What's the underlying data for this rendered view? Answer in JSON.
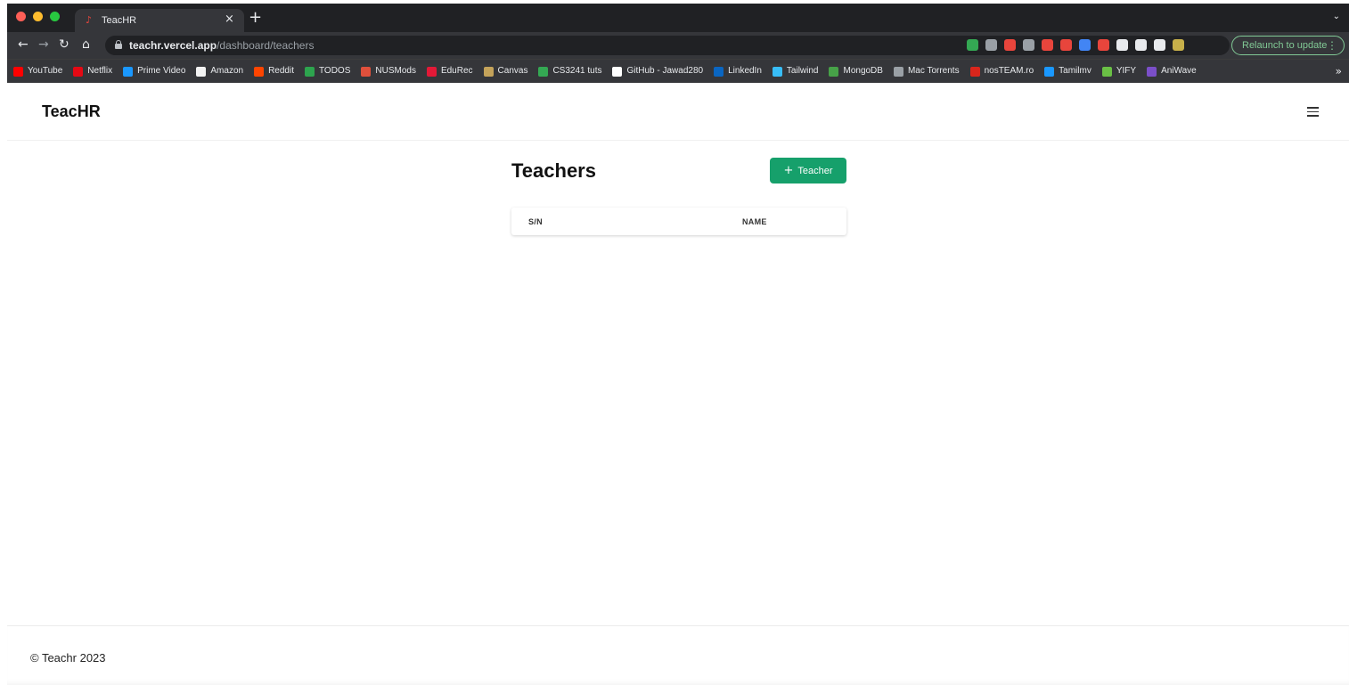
{
  "browser": {
    "tab_title": "TeacHR",
    "url_host": "teachr.vercel.app",
    "url_path": "/dashboard/teachers",
    "relaunch_label": "Relaunch to update",
    "bookmarks": [
      {
        "label": "YouTube",
        "color": "#ff0000"
      },
      {
        "label": "Netflix",
        "color": "#e50914"
      },
      {
        "label": "Prime Video",
        "color": "#1a98ff"
      },
      {
        "label": "Amazon",
        "color": "#f2f2f2"
      },
      {
        "label": "Reddit",
        "color": "#ff4500"
      },
      {
        "label": "TODOS",
        "color": "#2da44e"
      },
      {
        "label": "NUSMods",
        "color": "#e0503c"
      },
      {
        "label": "EduRec",
        "color": "#e31937"
      },
      {
        "label": "Canvas",
        "color": "#c4a35a"
      },
      {
        "label": "CS3241 tuts",
        "color": "#34a853"
      },
      {
        "label": "GitHub - Jawad280",
        "color": "#ffffff"
      },
      {
        "label": "LinkedIn",
        "color": "#0a66c2"
      },
      {
        "label": "Tailwind",
        "color": "#38bdf8"
      },
      {
        "label": "MongoDB",
        "color": "#47a248"
      },
      {
        "label": "Mac Torrents",
        "color": "#9aa0a6"
      },
      {
        "label": "nosTEAM.ro",
        "color": "#d9261c"
      },
      {
        "label": "Tamilmv",
        "color": "#1a98ff"
      },
      {
        "label": "YIFY",
        "color": "#6ac045"
      },
      {
        "label": "AniWave",
        "color": "#7b4fc9"
      }
    ],
    "extension_colors": [
      "#34a853",
      "#9aa0a6",
      "#e8453c",
      "#9aa0a6",
      "#e8453c",
      "#e8453c",
      "#4285f4",
      "#e8453c",
      "#e8eaed",
      "#e8eaed",
      "#e8eaed",
      "#c7b04a"
    ]
  },
  "site": {
    "brand": "TeacHR",
    "page_title": "Teachers",
    "add_button_label": "Teacher",
    "accent_color": "#16a06b",
    "table": {
      "headers": [
        "S/N",
        "NAME"
      ],
      "rows": []
    },
    "footer_text": "© Teachr 2023"
  }
}
